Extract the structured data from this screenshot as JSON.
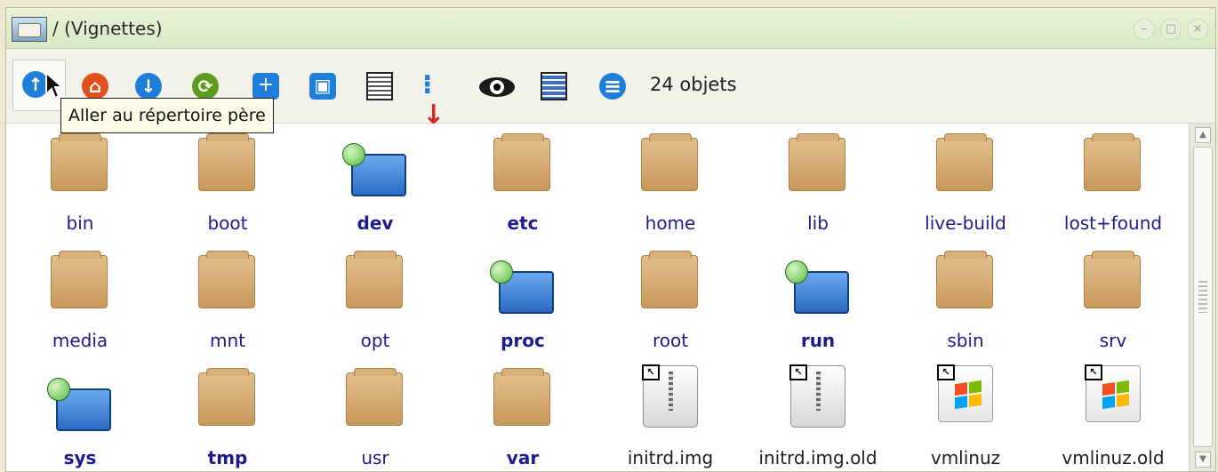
{
  "window": {
    "title": "/ (Vignettes)",
    "controls": {
      "minimize": "–",
      "maximize": "□",
      "close": "×"
    }
  },
  "toolbar": {
    "buttons": [
      {
        "name": "go-up",
        "icon": "arrow-up-icon",
        "glyph": "↑",
        "color": "#1f7fd8"
      },
      {
        "name": "home",
        "icon": "home-icon",
        "glyph": "⌂",
        "color": "#e0501c"
      },
      {
        "name": "go-down",
        "icon": "arrow-down-icon",
        "glyph": "↓",
        "color": "#1f7fd8"
      },
      {
        "name": "refresh",
        "icon": "refresh-icon",
        "glyph": "⟳",
        "color": "#5e9c1e"
      },
      {
        "name": "new-folder",
        "icon": "add-icon",
        "glyph": "+",
        "color": "#1f7fd8"
      },
      {
        "name": "select-all",
        "icon": "select-icon",
        "glyph": "▣",
        "color": "#1f7fd8"
      },
      {
        "name": "details-view",
        "icon": "list-icon"
      },
      {
        "name": "sort",
        "icon": "sort-icon",
        "glyph": "⁝↓",
        "color": "#d12a2a"
      },
      {
        "name": "show-hidden",
        "icon": "eye-icon",
        "glyph": "👁"
      },
      {
        "name": "compact-view",
        "icon": "columns-icon"
      },
      {
        "name": "menu",
        "icon": "menu-icon",
        "glyph": "≡",
        "color": "#1f7fd8"
      }
    ],
    "item_count": "24 objets"
  },
  "tooltip": "Aller au répertoire père",
  "items": [
    {
      "name": "bin",
      "type": "folder",
      "bold": false
    },
    {
      "name": "boot",
      "type": "folder",
      "bold": false
    },
    {
      "name": "dev",
      "type": "mount",
      "bold": true
    },
    {
      "name": "etc",
      "type": "folder",
      "bold": true
    },
    {
      "name": "home",
      "type": "folder",
      "bold": false
    },
    {
      "name": "lib",
      "type": "folder",
      "bold": false
    },
    {
      "name": "live-build",
      "type": "folder",
      "bold": false
    },
    {
      "name": "lost+found",
      "type": "folder",
      "bold": false
    },
    {
      "name": "media",
      "type": "folder",
      "bold": false
    },
    {
      "name": "mnt",
      "type": "folder",
      "bold": false
    },
    {
      "name": "opt",
      "type": "folder",
      "bold": false
    },
    {
      "name": "proc",
      "type": "mount",
      "bold": true
    },
    {
      "name": "root",
      "type": "folder",
      "bold": false
    },
    {
      "name": "run",
      "type": "mount",
      "bold": true
    },
    {
      "name": "sbin",
      "type": "folder",
      "bold": false
    },
    {
      "name": "srv",
      "type": "folder",
      "bold": false
    },
    {
      "name": "sys",
      "type": "mount",
      "bold": true
    },
    {
      "name": "tmp",
      "type": "folder",
      "bold": true
    },
    {
      "name": "usr",
      "type": "folder",
      "bold": false
    },
    {
      "name": "var",
      "type": "folder",
      "bold": true
    },
    {
      "name": "initrd.img",
      "type": "archive-link",
      "bold": false
    },
    {
      "name": "initrd.img.old",
      "type": "archive-link",
      "bold": false
    },
    {
      "name": "vmlinuz",
      "type": "kernel-link",
      "bold": false
    },
    {
      "name": "vmlinuz.old",
      "type": "kernel-link",
      "bold": false
    }
  ]
}
